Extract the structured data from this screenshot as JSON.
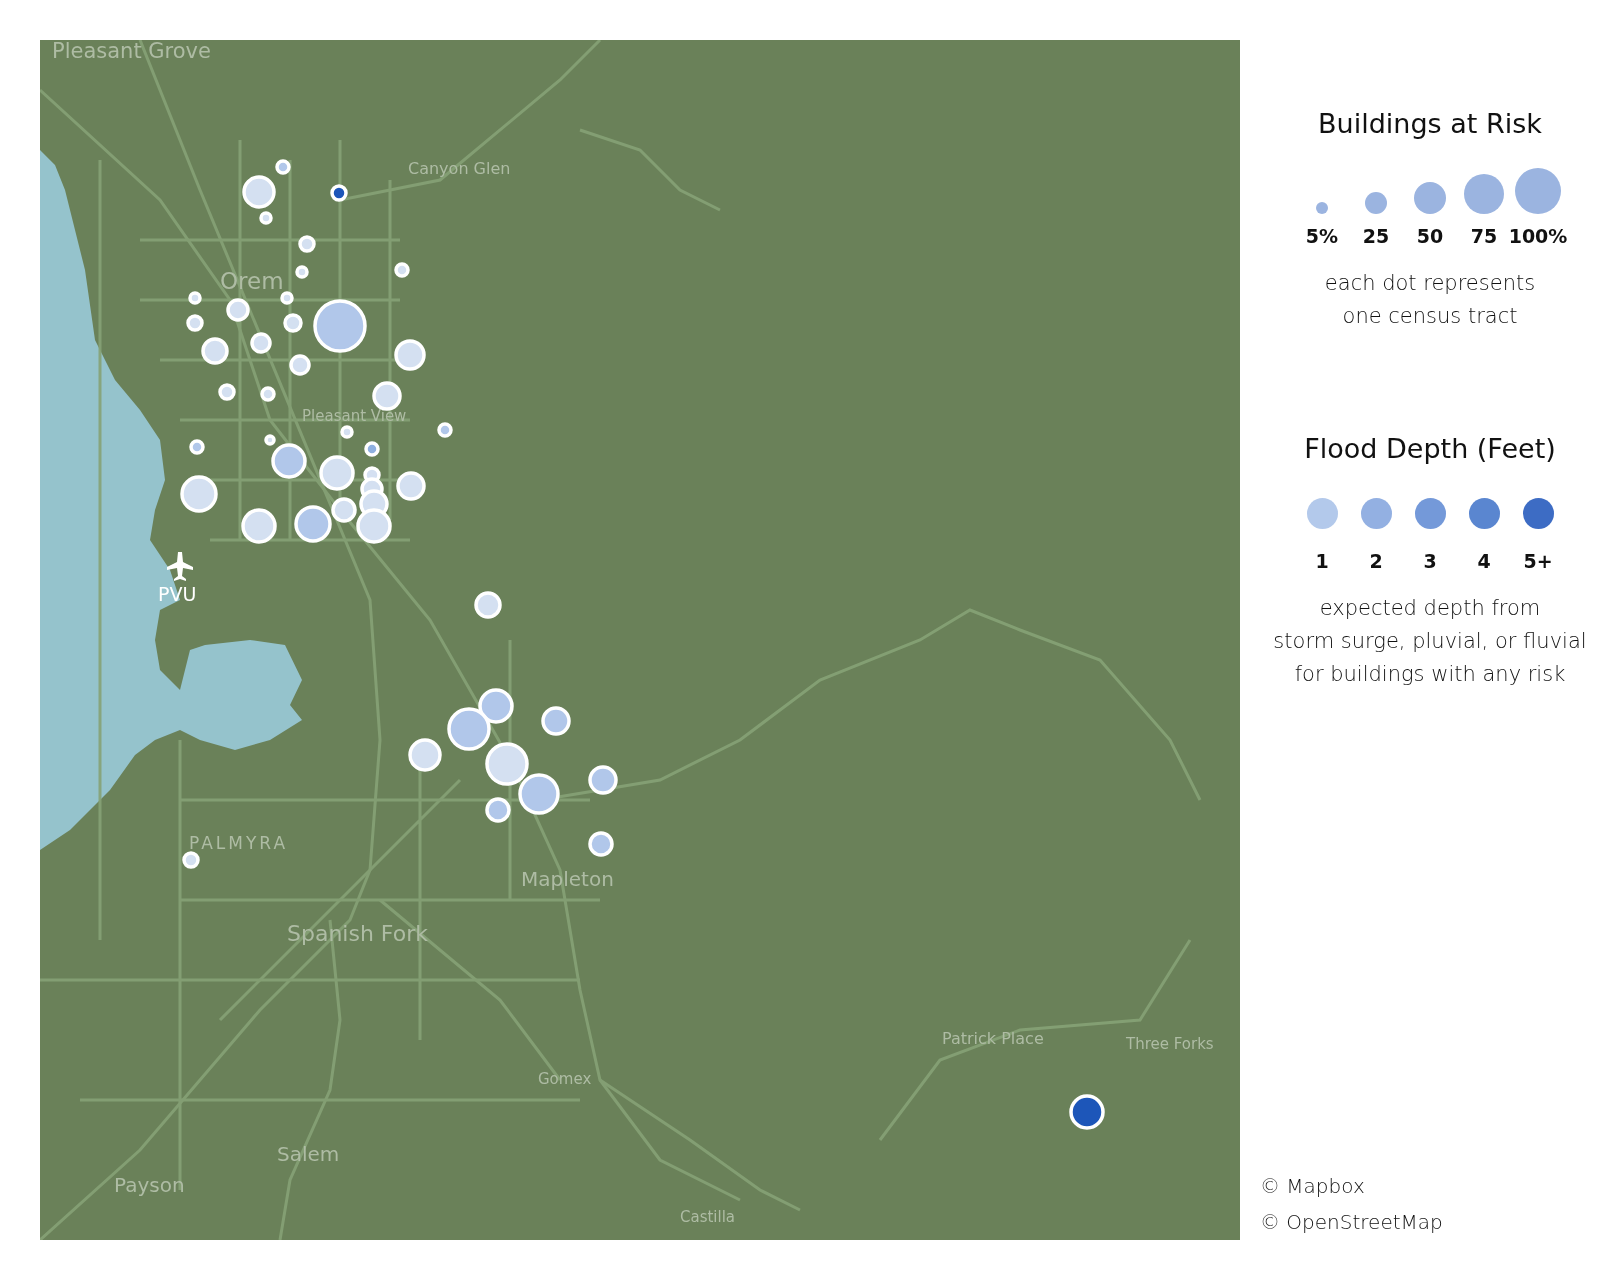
{
  "map": {
    "place_labels": [
      "Pleasant Grove",
      "Canyon Glen",
      "Orem",
      "Pleasant View",
      "PVU",
      "PALMYRA",
      "Mapleton",
      "Spanish Fork",
      "Gomex",
      "Salem",
      "Payson",
      "Patrick Place",
      "Three Forks",
      "Castilla"
    ]
  },
  "legend_risk": {
    "title": "Buildings at Risk",
    "items": [
      "5%",
      "25",
      "50",
      "75",
      "100%"
    ],
    "note": [
      "each dot represents",
      "one census tract"
    ]
  },
  "legend_depth": {
    "title": "Flood Depth (Feet)",
    "items": [
      {
        "label": "1",
        "color": "#b3c9eb"
      },
      {
        "label": "2",
        "color": "#93b0e2"
      },
      {
        "label": "3",
        "color": "#7499d9"
      },
      {
        "label": "4",
        "color": "#5a86d0"
      },
      {
        "label": "5+",
        "color": "#3d6cc4"
      }
    ],
    "note": [
      "expected depth from",
      "storm surge, pluvial, or fluvial",
      "for buildings with any risk"
    ]
  },
  "attribution": [
    "© Mapbox",
    "© OpenStreetMap"
  ]
}
